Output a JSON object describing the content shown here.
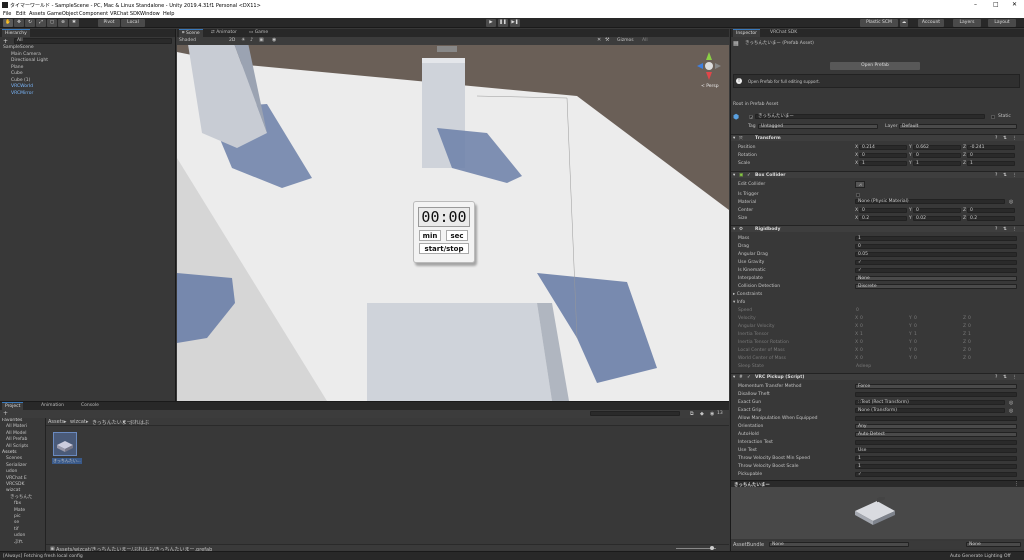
{
  "titlebar": {
    "title": "タイマーワールド - SampleScene - PC, Mac & Linux Standalone - Unity 2019.4.31f1 Personal <DX11>"
  },
  "menu": [
    "File",
    "Edit",
    "Assets",
    "GameObject",
    "Component",
    "VRChat SDK",
    "Window",
    "Help"
  ],
  "toolbar": {
    "pivot": "Pivot",
    "local": "Local",
    "plastic": "Plastic SCM",
    "account": "Account",
    "layers": "Layers",
    "layout": "Layout"
  },
  "hierarchy": {
    "tab": "Hierarchy",
    "create": "+",
    "search_placeholder": "All",
    "items": [
      {
        "label": "SampleScene",
        "indent": 0,
        "blue": false
      },
      {
        "label": "Main Camera",
        "indent": 2,
        "blue": false
      },
      {
        "label": "Directional Light",
        "indent": 2,
        "blue": false
      },
      {
        "label": "Plane",
        "indent": 2,
        "blue": false
      },
      {
        "label": "Cube",
        "indent": 2,
        "blue": false
      },
      {
        "label": "Cube (1)",
        "indent": 2,
        "blue": false
      },
      {
        "label": "VRCWorld",
        "indent": 2,
        "blue": true
      },
      {
        "label": "VRCMirror",
        "indent": 2,
        "blue": true
      }
    ]
  },
  "scene": {
    "tabs": [
      "Scene",
      "Animator",
      "Game"
    ],
    "shading": "Shaded",
    "mode2d": "2D",
    "gizmos": "Gizmos",
    "search": "All",
    "persp": "< Persp",
    "timer": {
      "display": "00:00",
      "min": "min",
      "sec": "sec",
      "startstop": "start/stop"
    }
  },
  "project": {
    "tabs": [
      "Project",
      "Animation",
      "Console"
    ],
    "count": "13",
    "breadcrumb": [
      "Assets",
      "wizcat",
      "きっちんたいまー",
      "ぷれはぶ"
    ],
    "tree": [
      {
        "label": "Favorites",
        "indent": 0,
        "bold": true
      },
      {
        "label": "All Materi",
        "indent": 2
      },
      {
        "label": "All Model",
        "indent": 2
      },
      {
        "label": "All Prefab",
        "indent": 2
      },
      {
        "label": "All Scripts",
        "indent": 2
      },
      {
        "label": "Assets",
        "indent": 0,
        "bold": true
      },
      {
        "label": "Scenes",
        "indent": 2
      },
      {
        "label": "Serializer",
        "indent": 2
      },
      {
        "label": "udon",
        "indent": 2
      },
      {
        "label": "VRChat E",
        "indent": 2
      },
      {
        "label": "VRCSDK",
        "indent": 2
      },
      {
        "label": "wizcat",
        "indent": 2
      },
      {
        "label": "きっちんた",
        "indent": 4
      },
      {
        "label": "fbx",
        "indent": 6
      },
      {
        "label": "Mate",
        "indent": 6
      },
      {
        "label": "pic",
        "indent": 6
      },
      {
        "label": "se",
        "indent": 6
      },
      {
        "label": "tif",
        "indent": 6
      },
      {
        "label": "udon",
        "indent": 6
      },
      {
        "label": "ぷれ",
        "indent": 6
      }
    ],
    "asset": "きっちんたい...",
    "footer": "Assets/wizcat/きっちんたいまー/ぷれはぶ/きっちんたいまー.prefab"
  },
  "inspector": {
    "tabs": [
      "Inspector",
      "VRChat SDK"
    ],
    "asset_title": "きっちんたいまー (Prefab Asset)",
    "open_prefab": "Open Prefab",
    "info": "Open Prefab for full editing support.",
    "root": "Root in Prefab Asset",
    "object_name": "きっちんたいまー",
    "static": "Static",
    "tag_label": "Tag",
    "tag": "Untagged",
    "layer_label": "Layer",
    "layer": "Default",
    "transform": {
      "title": "Transform",
      "rows": [
        {
          "label": "Position",
          "x": "0.214",
          "y": "0.662",
          "z": "-0.241"
        },
        {
          "label": "Rotation",
          "x": "0",
          "y": "0",
          "z": "0"
        },
        {
          "label": "Scale",
          "x": "1",
          "y": "1",
          "z": "1"
        }
      ]
    },
    "box_collider": {
      "title": "Box Collider",
      "edit": "Edit Collider",
      "trigger": "Is Trigger",
      "material": "Material",
      "material_val": "None (Physic Material)",
      "center_label": "Center",
      "center": {
        "x": "0",
        "y": "0",
        "z": "0"
      },
      "size_label": "Size",
      "size": {
        "x": "0.2",
        "y": "0.02",
        "z": "0.2"
      }
    },
    "rigidbody": {
      "title": "Rigidbody",
      "rows": [
        {
          "label": "Mass",
          "value": "1"
        },
        {
          "label": "Drag",
          "value": "0"
        },
        {
          "label": "Angular Drag",
          "value": "0.05"
        },
        {
          "label": "Use Gravity",
          "value": "✓"
        },
        {
          "label": "Is Kinematic",
          "value": "✓"
        },
        {
          "label": "Interpolate",
          "value": "None"
        },
        {
          "label": "Collision Detection",
          "value": "Discrete"
        }
      ],
      "constraints": "Constraints",
      "info": "Info",
      "info_rows": [
        {
          "label": "Speed",
          "single": "0"
        },
        {
          "label": "Velocity",
          "x": "0",
          "y": "0",
          "z": "0"
        },
        {
          "label": "Angular Velocity",
          "x": "0",
          "y": "0",
          "z": "0"
        },
        {
          "label": "Inertia Tensor",
          "x": "1",
          "y": "1",
          "z": "1"
        },
        {
          "label": "Inertia Tensor Rotation",
          "x": "0",
          "y": "0",
          "z": "0"
        },
        {
          "label": "Local Center of Mass",
          "x": "0",
          "y": "0",
          "z": "0"
        },
        {
          "label": "World Center of Mass",
          "x": "0",
          "y": "0",
          "z": "0"
        },
        {
          "label": "Sleep State",
          "single": "Asleep"
        }
      ]
    },
    "pickup": {
      "title": "VRC Pickup (Script)",
      "rows": [
        {
          "label": "Momentum Transfer Method",
          "value": "Force"
        },
        {
          "label": "Disallow Theft",
          "value": ""
        },
        {
          "label": "Exact Gun",
          "value": "::Text (Rect Transform)"
        },
        {
          "label": "Exact Grip",
          "value": "None (Transform)"
        },
        {
          "label": "Allow Manipulation When Equipped",
          "value": ""
        },
        {
          "label": "Orientation",
          "value": "Any"
        },
        {
          "label": "AutoHold",
          "value": "Auto Detect"
        },
        {
          "label": "Interaction Text",
          "value": ""
        },
        {
          "label": "Use Text",
          "value": "Use"
        },
        {
          "label": "Throw Velocity Boost Min Speed",
          "value": "1"
        },
        {
          "label": "Throw Velocity Boost Scale",
          "value": "1"
        },
        {
          "label": "Pickupable",
          "value": "✓"
        }
      ]
    },
    "preview_title": "きっちんたいまー",
    "assetbundle_label": "AssetBundle",
    "assetbundle": "None",
    "assetvariant": "None"
  },
  "status": {
    "message": "[Always] Fetching fresh local config",
    "right": "Auto Generate Lighting Off"
  }
}
